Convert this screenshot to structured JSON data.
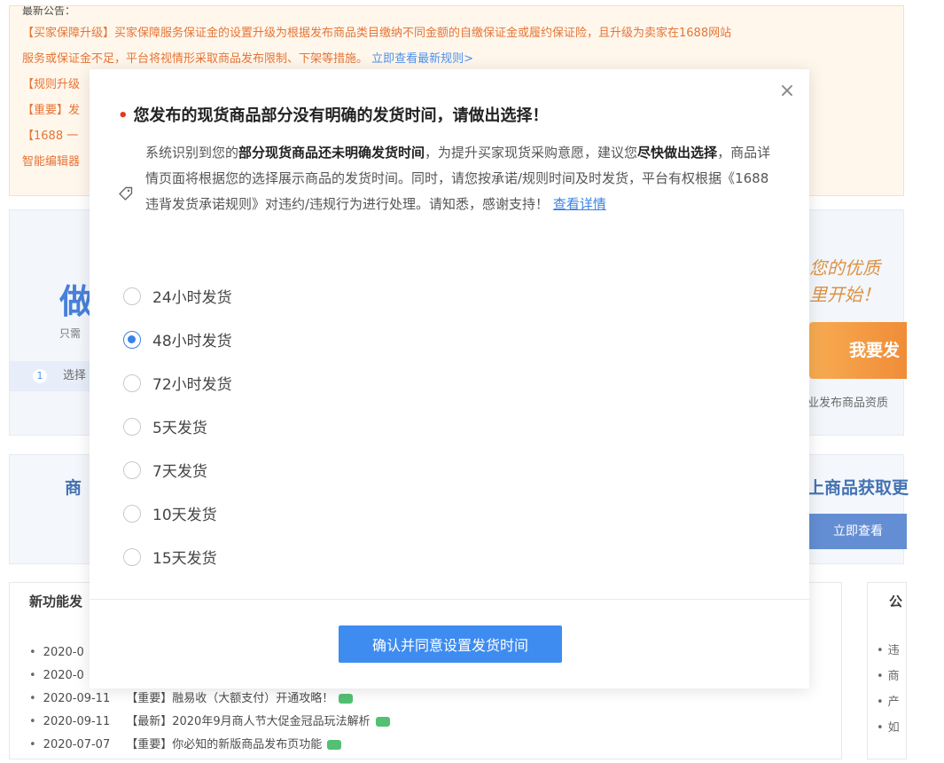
{
  "background": {
    "notice": {
      "title": "最新公告：",
      "lines": [
        "【买家保障升级】买家保障服务保证金的设置升级为根据发布商品类目缴纳不同金额的自缴保证金或履约保证险，且升级为卖家在1688网站",
        "服务或保证金不足，平台将视情形采取商品发布限制、下架等措施。",
        "【规则升级",
        "【重要】发",
        "【1688 一",
        "智能编辑器"
      ],
      "link_text": "立即查看最新规则>"
    },
    "hero": {
      "big_text": "做",
      "sub_text": "只需",
      "step_number": "1",
      "step_text": "选择",
      "hand_text_line1": "您的优质",
      "hand_text_line2": "里开始！",
      "publish_button": "我要发",
      "qualification_text": "业发布商品资质"
    },
    "mid": {
      "left_text": "商",
      "right_text": "上商品获取更",
      "view_button": "立即查看"
    },
    "news": {
      "title": "新功能发",
      "items": [
        {
          "date": "2020-0",
          "text": ""
        },
        {
          "date": "2020-0",
          "text": ""
        },
        {
          "date": "2020-09-11",
          "text": "【重要】融易收（大额支付）开通攻略！"
        },
        {
          "date": "2020-09-11",
          "text": "【最新】2020年9月商人节大促金冠品玩法解析"
        },
        {
          "date": "2020-07-07",
          "text": "【重要】你必知的新版商品发布页功能"
        }
      ]
    },
    "public": {
      "title": "公",
      "items": [
        "违",
        "商",
        "产",
        "如"
      ]
    }
  },
  "modal": {
    "title": "您发布的现货商品部分没有明确的发货时间，请做出选择！",
    "required_mark": "•",
    "desc_part1": "系统识别到您的",
    "desc_bold1": "部分现货商品还未明确发货时间",
    "desc_part2": "，为提升买家现货采购意愿，建议您",
    "desc_bold2": "尽快做出选择",
    "desc_part3": "，商品详情页面将根据您的选择展示商品的发货时间。同时，请您按承诺/规则时间及时发货，平台有权根据《1688违背发货承诺规则》对违约/违规行为进行处理。请知悉，感谢支持！",
    "detail_link": "查看详情",
    "options": [
      {
        "label": "24小时发货",
        "checked": false
      },
      {
        "label": "48小时发货",
        "checked": true
      },
      {
        "label": "72小时发货",
        "checked": false
      },
      {
        "label": "5天发货",
        "checked": false
      },
      {
        "label": "7天发货",
        "checked": false
      },
      {
        "label": "10天发货",
        "checked": false
      },
      {
        "label": "15天发货",
        "checked": false
      }
    ],
    "close_symbol": "×",
    "confirm_button": "确认并同意设置发货时间"
  }
}
